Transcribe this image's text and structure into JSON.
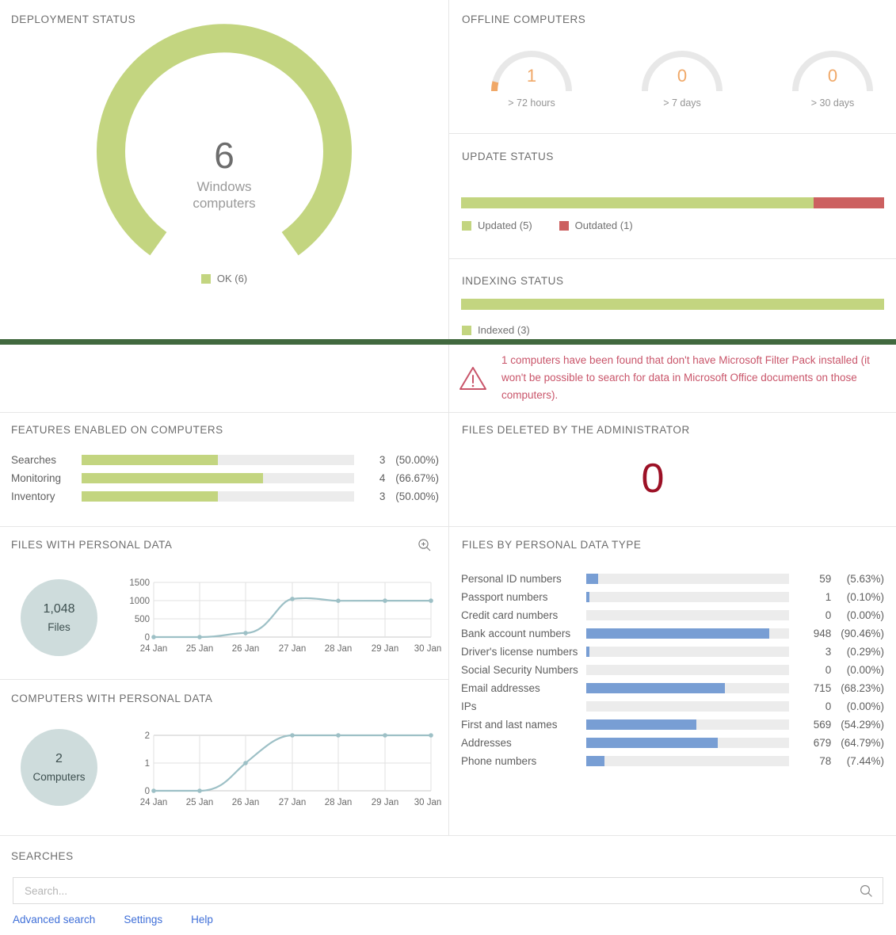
{
  "deployment": {
    "title": "DEPLOYMENT STATUS",
    "value": "6",
    "caption_line1": "Windows",
    "caption_line2": "computers",
    "legend": [
      {
        "label": "OK (6)",
        "color": "#c3d580"
      }
    ]
  },
  "offline": {
    "title": "OFFLINE COMPUTERS",
    "gauges": [
      {
        "value": "1",
        "caption": "> 72 hours",
        "fraction": 0.12
      },
      {
        "value": "0",
        "caption": "> 7 days",
        "fraction": 0
      },
      {
        "value": "0",
        "caption": "> 30 days",
        "fraction": 0
      }
    ],
    "value_color": "#f0a868",
    "track_color": "#e8e8e8"
  },
  "update_status": {
    "title": "UPDATE STATUS",
    "segments": [
      {
        "label": "Updated (5)",
        "color": "#c3d580",
        "percent": 83.33
      },
      {
        "label": "Outdated (1)",
        "color": "#cc6060",
        "percent": 16.67
      }
    ]
  },
  "indexing_status": {
    "title": "INDEXING STATUS",
    "segments": [
      {
        "label": "Indexed (3)",
        "color": "#c3d580",
        "percent": 100
      }
    ]
  },
  "warning": {
    "icon": "warning-triangle-icon",
    "text": "1 computers have been found that don't have Microsoft Filter Pack installed (it won't be possible to search for data in Microsoft Office documents on those computers).",
    "color": "#c9556a"
  },
  "features": {
    "title": "FEATURES ENABLED ON COMPUTERS",
    "rows": [
      {
        "name": "Searches",
        "value": "3",
        "percent_label": "(50.00%)",
        "percent": 50.0
      },
      {
        "name": "Monitoring",
        "value": "4",
        "percent_label": "(66.67%)",
        "percent": 66.67
      },
      {
        "name": "Inventory",
        "value": "3",
        "percent_label": "(50.00%)",
        "percent": 50.0
      }
    ],
    "bar_color": "#c3d580"
  },
  "deleted_files": {
    "title": "FILES DELETED BY THE ADMINISTRATOR",
    "value": "0",
    "color": "#9c1126"
  },
  "files_personal": {
    "title": "FILES WITH PERSONAL DATA",
    "zoom_icon": "zoom-in-icon",
    "badge_value": "1,048",
    "badge_caption": "Files"
  },
  "computers_personal": {
    "title": "COMPUTERS WITH PERSONAL DATA",
    "badge_value": "2",
    "badge_caption": "Computers"
  },
  "data_types": {
    "title": "FILES BY PERSONAL DATA TYPE",
    "bar_color": "#789ed4",
    "rows": [
      {
        "name": "Personal ID numbers",
        "value": "59",
        "percent_label": "(5.63%)",
        "percent": 5.63
      },
      {
        "name": "Passport numbers",
        "value": "1",
        "percent_label": "(0.10%)",
        "percent": 0.1
      },
      {
        "name": "Credit card numbers",
        "value": "0",
        "percent_label": "(0.00%)",
        "percent": 0.0
      },
      {
        "name": "Bank account numbers",
        "value": "948",
        "percent_label": "(90.46%)",
        "percent": 90.46
      },
      {
        "name": "Driver's license numbers",
        "value": "3",
        "percent_label": "(0.29%)",
        "percent": 0.29
      },
      {
        "name": "Social Security Numbers",
        "value": "0",
        "percent_label": "(0.00%)",
        "percent": 0.0
      },
      {
        "name": "Email addresses",
        "value": "715",
        "percent_label": "(68.23%)",
        "percent": 68.23
      },
      {
        "name": "IPs",
        "value": "0",
        "percent_label": "(0.00%)",
        "percent": 0.0
      },
      {
        "name": "First and last names",
        "value": "569",
        "percent_label": "(54.29%)",
        "percent": 54.29
      },
      {
        "name": "Addresses",
        "value": "679",
        "percent_label": "(64.79%)",
        "percent": 64.79
      },
      {
        "name": "Phone numbers",
        "value": "78",
        "percent_label": "(7.44%)",
        "percent": 7.44
      }
    ]
  },
  "searches": {
    "title": "SEARCHES",
    "placeholder": "Search...",
    "value": "",
    "search_icon": "search-icon",
    "links": [
      {
        "label": "Advanced search"
      },
      {
        "label": "Settings"
      },
      {
        "label": "Help"
      }
    ],
    "link_color": "#3f6fd8"
  },
  "chart_data": [
    {
      "type": "line",
      "title": "FILES WITH PERSONAL DATA",
      "x": [
        "24 Jan",
        "25 Jan",
        "26 Jan",
        "27 Jan",
        "28 Jan",
        "29 Jan",
        "30 Jan"
      ],
      "values": [
        0,
        0,
        110,
        1048,
        1043,
        1045,
        1045
      ],
      "yticks": [
        0,
        500,
        1000,
        1500
      ],
      "ylim": [
        0,
        1500
      ],
      "xlabel": "",
      "ylabel": "",
      "grid": true,
      "legend": "none",
      "series_color": "#9dc0c6",
      "total_label": "1,048",
      "total_caption": "Files"
    },
    {
      "type": "line",
      "title": "COMPUTERS WITH PERSONAL DATA",
      "x": [
        "24 Jan",
        "25 Jan",
        "26 Jan",
        "27 Jan",
        "28 Jan",
        "29 Jan",
        "30 Jan"
      ],
      "values": [
        0,
        0,
        1,
        2,
        2,
        2,
        2
      ],
      "yticks": [
        0,
        1,
        2
      ],
      "ylim": [
        0,
        2
      ],
      "xlabel": "",
      "ylabel": "",
      "grid": true,
      "legend": "none",
      "series_color": "#9dc0c6",
      "total_label": "2",
      "total_caption": "Computers"
    },
    {
      "type": "bar",
      "title": "FILES BY PERSONAL DATA TYPE",
      "categories": [
        "Personal ID numbers",
        "Passport numbers",
        "Credit card numbers",
        "Bank account numbers",
        "Driver's license numbers",
        "Social Security Numbers",
        "Email addresses",
        "IPs",
        "First and last names",
        "Addresses",
        "Phone numbers"
      ],
      "values": [
        59,
        1,
        0,
        948,
        3,
        0,
        715,
        0,
        569,
        679,
        78
      ],
      "percents": [
        5.63,
        0.1,
        0.0,
        90.46,
        0.29,
        0.0,
        68.23,
        0.0,
        54.29,
        64.79,
        7.44
      ],
      "orientation": "horizontal",
      "xlim": [
        0,
        1048
      ],
      "series_color": "#789ed4"
    },
    {
      "type": "bar",
      "title": "FEATURES ENABLED ON COMPUTERS",
      "categories": [
        "Searches",
        "Monitoring",
        "Inventory"
      ],
      "values": [
        3,
        4,
        3
      ],
      "percents": [
        50.0,
        66.67,
        50.0
      ],
      "orientation": "horizontal",
      "xlim": [
        0,
        6
      ],
      "series_color": "#c3d580"
    },
    {
      "type": "pie",
      "title": "DEPLOYMENT STATUS",
      "labels": [
        "OK"
      ],
      "values": [
        6
      ],
      "center_value": "6",
      "center_caption": "Windows computers",
      "series_color": "#c3d580"
    }
  ]
}
